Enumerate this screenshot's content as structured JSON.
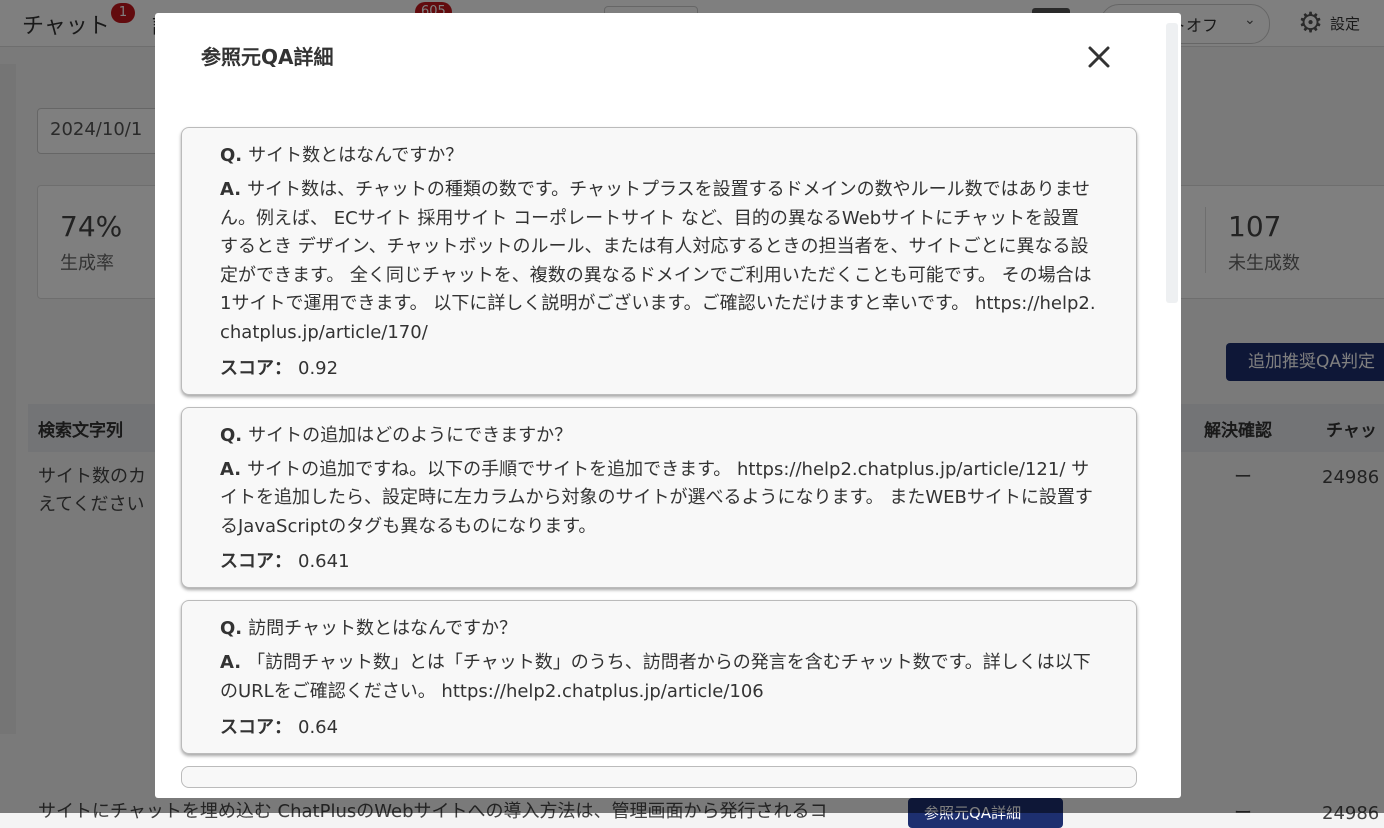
{
  "nav": {
    "chat_label": "チャット",
    "chat_badge": "1",
    "second_label": "訓",
    "second_badge": "605",
    "status_label": "トオフ",
    "settings_label": "設定"
  },
  "filter": {
    "date": "2024/10/1"
  },
  "stats": {
    "rate_value": "74%",
    "rate_label": "生成率",
    "ungenerated_value": "107",
    "ungenerated_label": "未生成数"
  },
  "add_button_label": "追加推奨QA判定",
  "table": {
    "col_search": "検索文字列",
    "col_resolved": "解決確認",
    "col_chat": "チャッ",
    "row1_text_line1": "サイト数のカ",
    "row1_text_line2": "えてください",
    "row1_resolved": "ー",
    "row1_chat": "24986",
    "row2_text": "サイトにチャットを埋め込む ChatPlusのWebサイトへの導入方法は、管理画面から発行されるコ",
    "row2_button": "参照元QA詳細",
    "row2_resolved": "ー",
    "row2_chat": "24986"
  },
  "modal": {
    "title": "参照元QA詳細",
    "q_prefix": "Q.",
    "a_prefix": "A.",
    "score_label": "スコア：",
    "items": [
      {
        "question": "サイト数とはなんですか？",
        "answer": "サイト数は、チャットの種類の数です。チャットプラスを設置するドメインの数やルール数ではありません。例えば、 ECサイト 採用サイト コーポレートサイト など、目的の異なるWebサイトにチャットを設置するとき デザイン、チャットボットのルール、または有人対応するときの担当者を、サイトごとに異なる設定ができます。 全く同じチャットを、複数の異なるドメインでご利用いただくことも可能です。 その場合は1サイトで運用できます。 以下に詳しく説明がございます。ご確認いただけますと幸いです。 https://help2.chatplus.jp/article/170/",
        "score": "0.92"
      },
      {
        "question": "サイトの追加はどのようにできますか？",
        "answer": "サイトの追加ですね。以下の手順でサイトを追加できます。 https://help2.chatplus.jp/article/121/ サイトを追加したら、設定時に左カラムから対象のサイトが選べるようになります。 またWEBサイトに設置するJavaScriptのタグも異なるものになります。",
        "score": "0.641"
      },
      {
        "question": "訪問チャット数とはなんですか？",
        "answer": "「訪問チャット数」とは「チャット数」のうち、訪問者からの発言を含むチャット数です。詳しくは以下のURLをご確認ください。 https://help2.chatplus.jp/article/106",
        "score": "0.64"
      }
    ]
  }
}
